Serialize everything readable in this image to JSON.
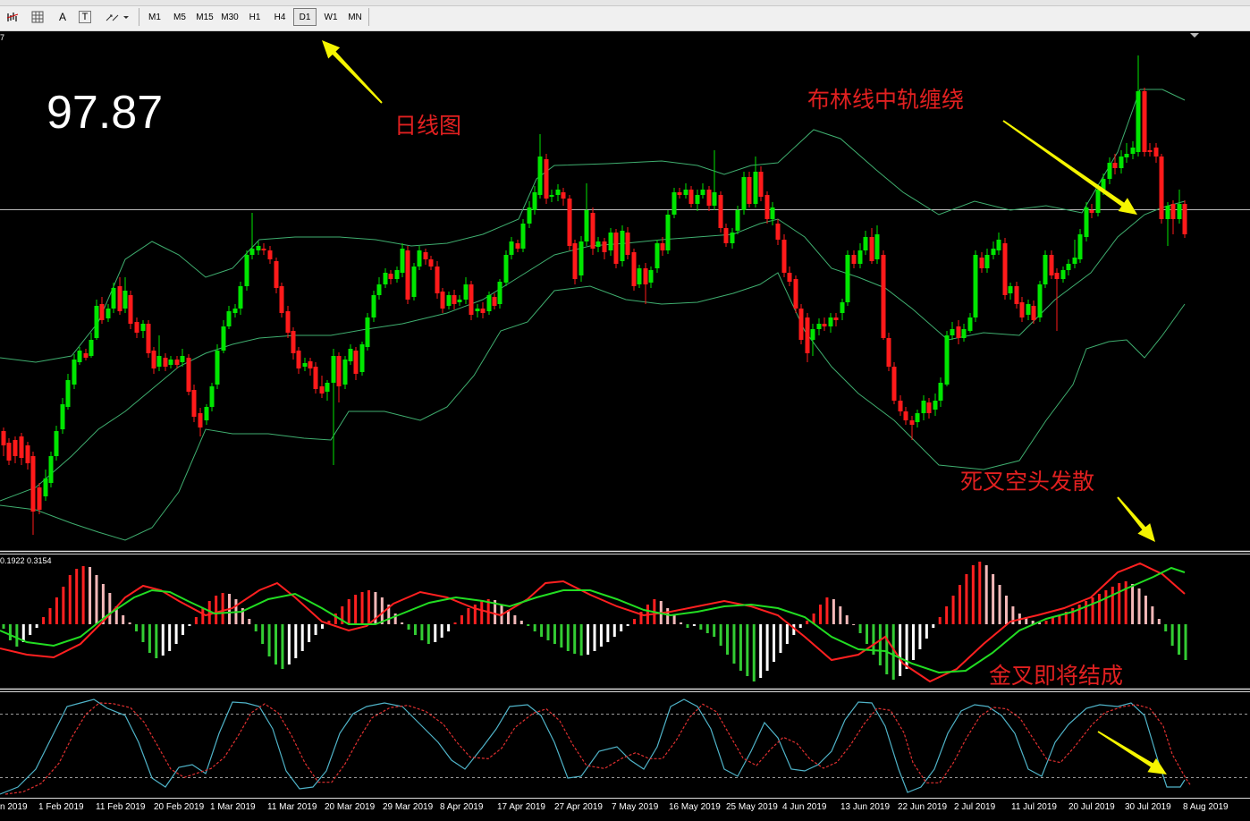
{
  "toolbar": {
    "tools": [
      "bar-chart-icon",
      "grid-icon",
      "text-icon",
      "text-label-icon",
      "arrows-icon"
    ],
    "tools_text": {
      "text": "A",
      "label": "T"
    },
    "timeframes": [
      "M1",
      "M5",
      "M15",
      "M30",
      "H1",
      "H4",
      "D1",
      "W1",
      "MN"
    ],
    "active_timeframe": "D1"
  },
  "chart": {
    "price_display": "97.87",
    "corner_label": "7",
    "macd_label": "0.1922 0.3154",
    "date_labels": [
      "n 2019",
      "1 Feb 2019",
      "11 Feb 2019",
      "20 Feb 2019",
      "1 Mar 2019",
      "11 Mar 2019",
      "20 Mar 2019",
      "29 Mar 2019",
      "8 Apr 2019",
      "17 Apr 2019",
      "27 Apr 2019",
      "7 May 2019",
      "16 May 2019",
      "25 May 2019",
      "4 Jun 2019",
      "13 Jun 2019",
      "22 Jun 2019",
      "2 Jul 2019",
      "11 Jul 2019",
      "20 Jul 2019",
      "30 Jul 2019",
      "8 Aug 2019"
    ],
    "annotations": {
      "daily_chart": "日线图",
      "bollinger_mid": "布林线中轨缠绕",
      "dead_cross": "死叉空头发散",
      "golden_cross": "金叉即将结成"
    },
    "colors": {
      "bull": "#00e600",
      "bear": "#ff1a1a",
      "band": "#3fae6f",
      "macd_signal": "#ff2020",
      "macd_line": "#22dd22",
      "kdj_k": "#4fb3c8",
      "kdj_d": "#e03030",
      "annotation": "#e02020",
      "arrow": "#f5f500"
    }
  }
}
